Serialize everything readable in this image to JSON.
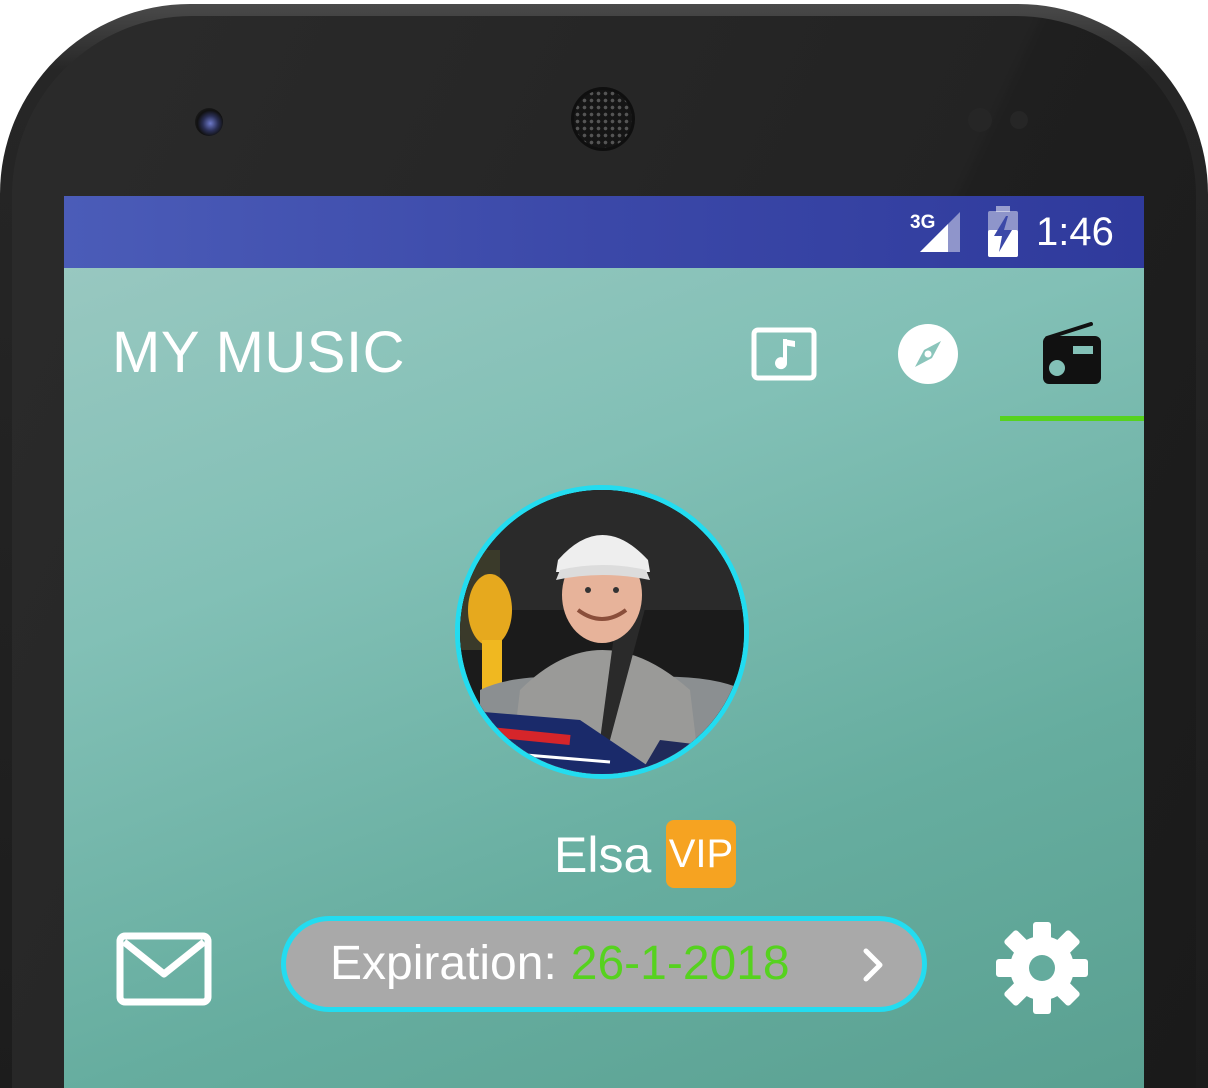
{
  "status_bar": {
    "network_label": "3G",
    "time": "1:46",
    "signal_icon": "cell-signal-icon",
    "battery_icon": "battery-charging-icon",
    "color": "#3f4fae"
  },
  "header": {
    "title": "MY MUSIC",
    "tabs": [
      {
        "name": "my-music",
        "icon": "music-note-icon",
        "selected": false
      },
      {
        "name": "discover",
        "icon": "compass-icon",
        "selected": false
      },
      {
        "name": "radio",
        "icon": "radio-icon",
        "selected": true
      }
    ],
    "indicator_color": "#56d21f"
  },
  "profile": {
    "name": "Elsa",
    "badge": "VIP",
    "badge_color": "#f6a321",
    "avatar_ring_color": "#23dcf0"
  },
  "expiration": {
    "label": "Expiration:",
    "date": "26-1-2018",
    "date_color": "#56d21f",
    "chevron_icon": "chevron-right-icon"
  },
  "actions": {
    "mail_icon": "mail-icon",
    "settings_icon": "gear-icon"
  }
}
